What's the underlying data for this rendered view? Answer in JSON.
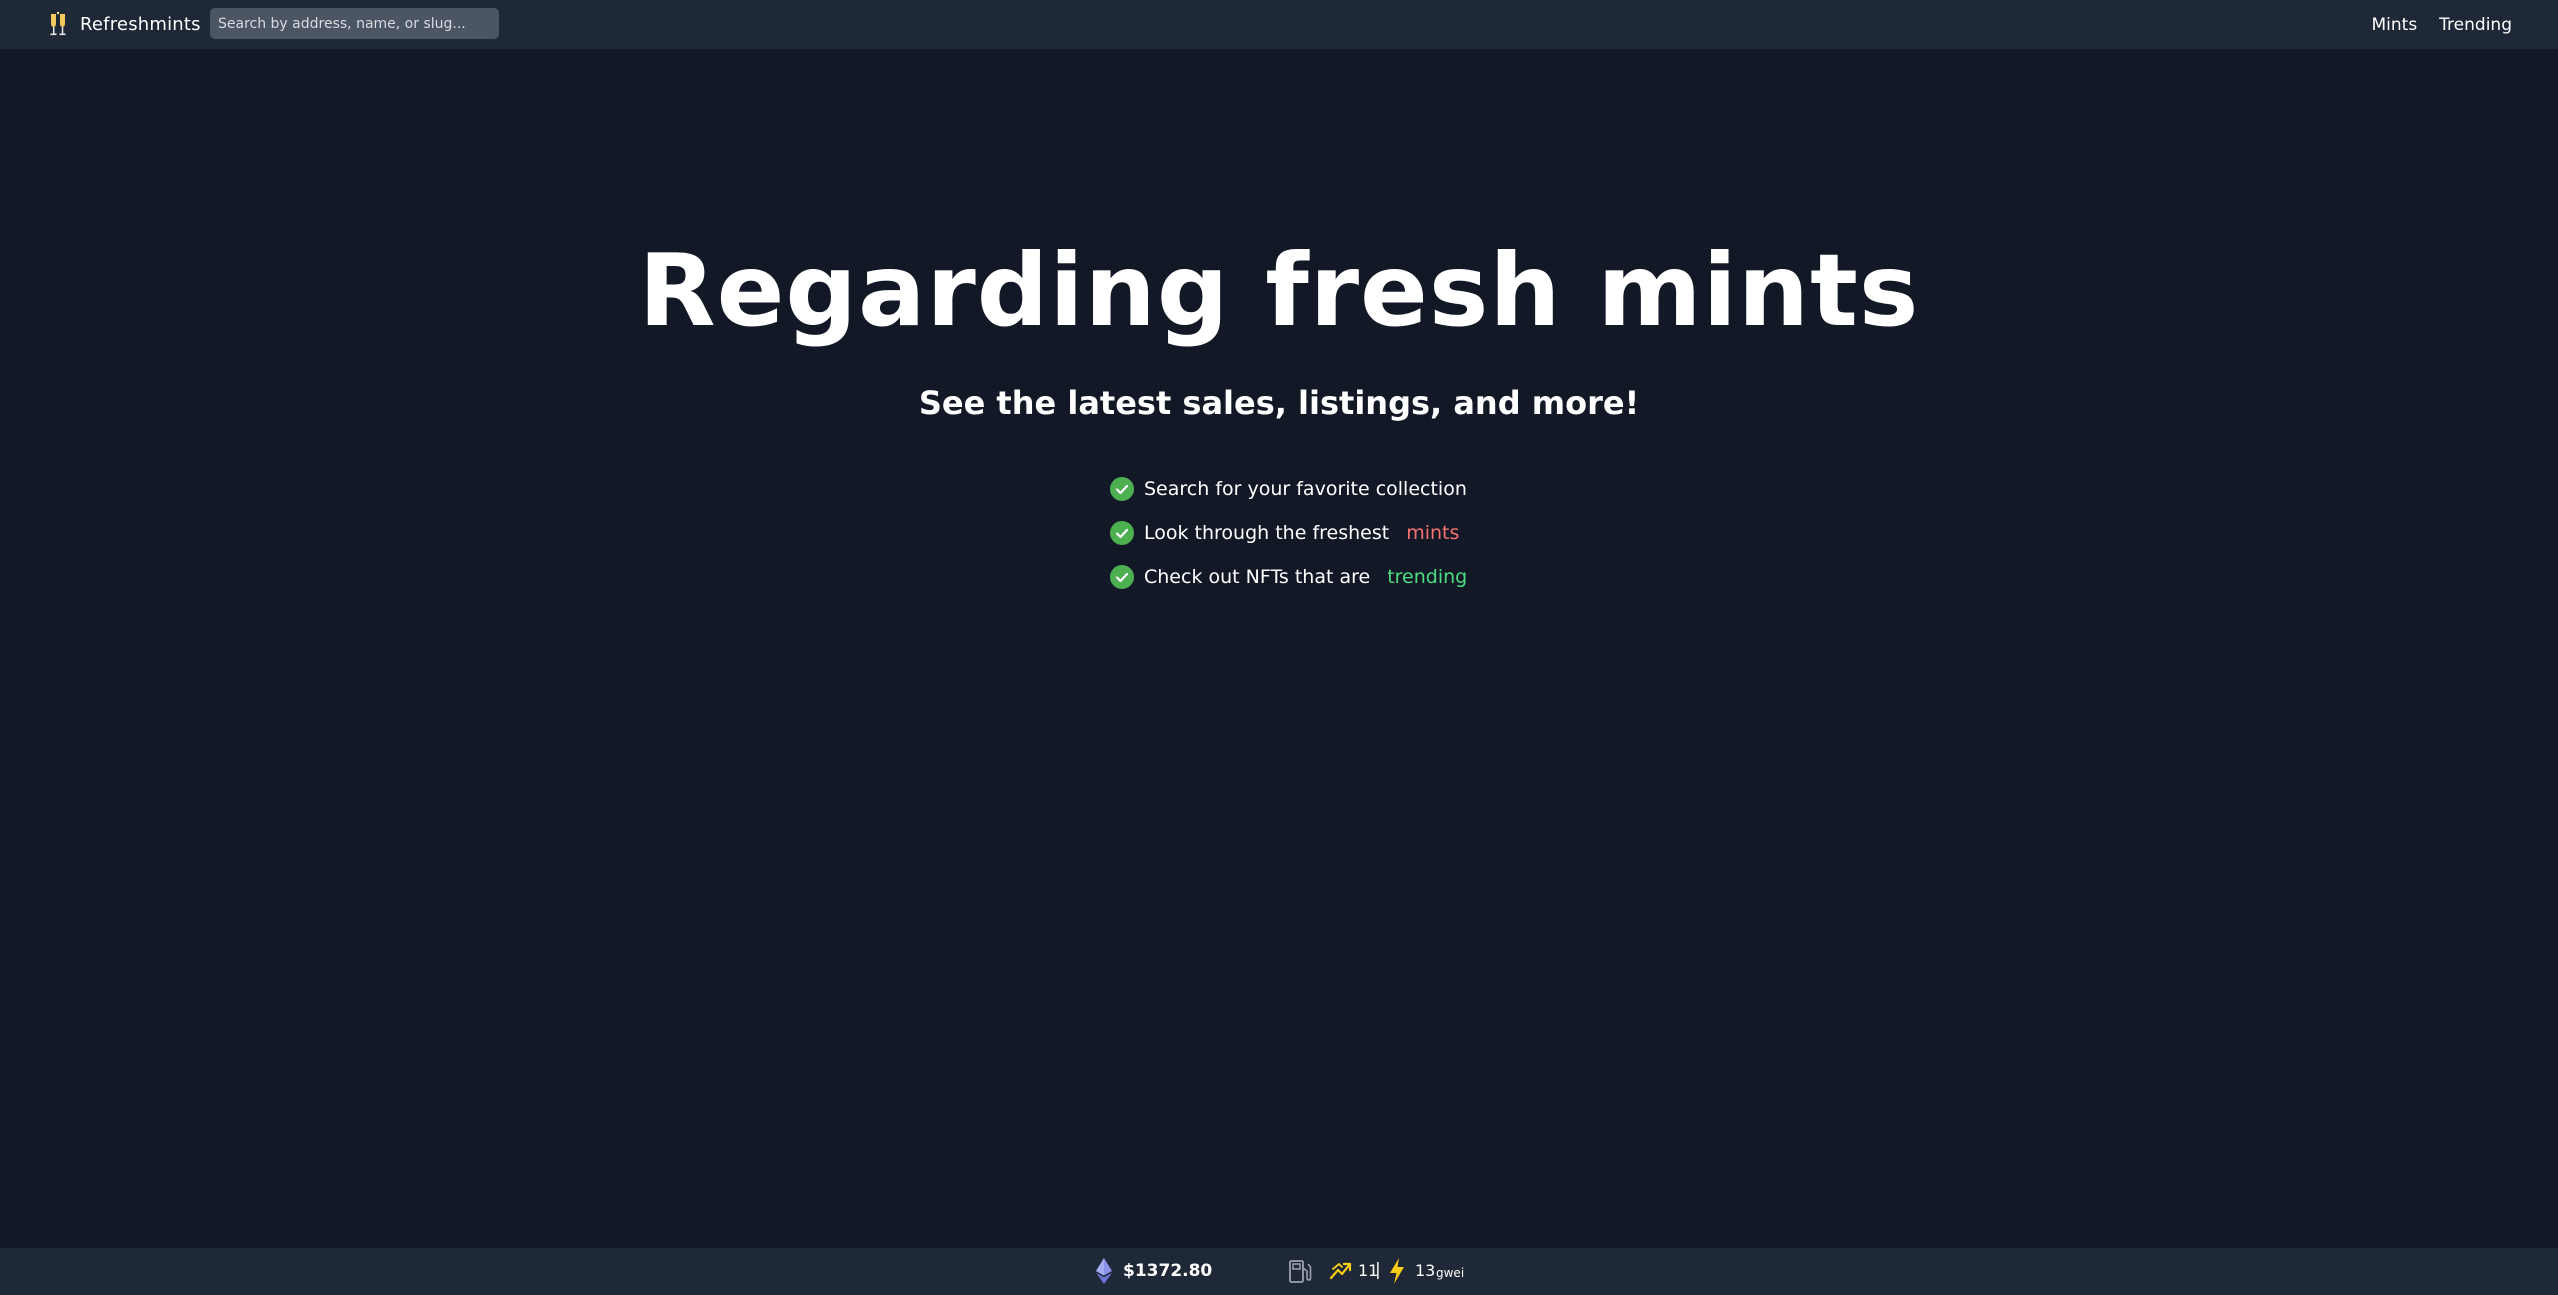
{
  "header": {
    "brand": "Refreshmints",
    "search_placeholder": "Search by address, name, or slug...",
    "nav": [
      {
        "label": "Mints"
      },
      {
        "label": "Trending"
      }
    ]
  },
  "hero": {
    "title": "Regarding fresh mints",
    "subtitle": "See the latest sales, listings, and more!",
    "features": [
      {
        "text": "Search for your favorite collection",
        "link": ""
      },
      {
        "text": "Look through the freshest",
        "link": "mints"
      },
      {
        "text": "Check out NFTs that are",
        "link": "trending"
      }
    ]
  },
  "footer": {
    "eth_price": "$1372.80",
    "gas_low": "11",
    "separator": "|",
    "gas_fast": "13",
    "gas_unit": "gwei"
  },
  "colors": {
    "background": "#121826",
    "bar": "#1f2836",
    "check": "#4caf50",
    "mints_link": "#f87171",
    "trending_link": "#4ade80",
    "bolt": "#facc15"
  },
  "icons": [
    "champagne-logo-icon",
    "check-circle-icon",
    "ethereum-icon",
    "gas-pump-icon",
    "trend-icon",
    "lightning-bolt-icon"
  ]
}
